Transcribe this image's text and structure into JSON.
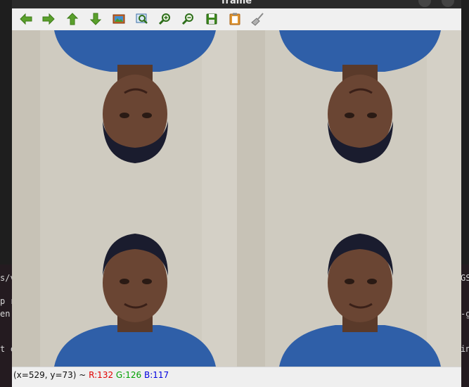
{
  "window": {
    "title": "frame"
  },
  "toolbar": {
    "tools": [
      {
        "name": "pan-left-button",
        "icon": "arrow-left-icon"
      },
      {
        "name": "pan-right-button",
        "icon": "arrow-right-icon"
      },
      {
        "name": "pan-up-button",
        "icon": "arrow-up-icon"
      },
      {
        "name": "pan-down-button",
        "icon": "arrow-down-icon"
      },
      {
        "name": "zoom-original-button",
        "icon": "image-icon"
      },
      {
        "name": "zoom-fit-button",
        "icon": "zoom-fit-icon"
      },
      {
        "name": "zoom-in-button",
        "icon": "zoom-in-icon"
      },
      {
        "name": "zoom-out-button",
        "icon": "zoom-out-icon"
      },
      {
        "name": "save-button",
        "icon": "save-icon"
      },
      {
        "name": "properties-button",
        "icon": "clipboard-icon"
      },
      {
        "name": "clear-button",
        "icon": "broom-icon"
      }
    ]
  },
  "status": {
    "coords": "(x=529, y=73) ~ ",
    "r": "R:132",
    "g": "G:126",
    "b": "B:117"
  },
  "terminal": {
    "left_lines": [
      "s/v",
      "p r",
      "en",
      "t c"
    ],
    "right_lines": [
      "GS",
      "-g",
      "in"
    ]
  },
  "colors": {
    "arrow_green": "#5aa02c",
    "wall": "#cfcbc0",
    "shirt": "#2f5fa8"
  }
}
